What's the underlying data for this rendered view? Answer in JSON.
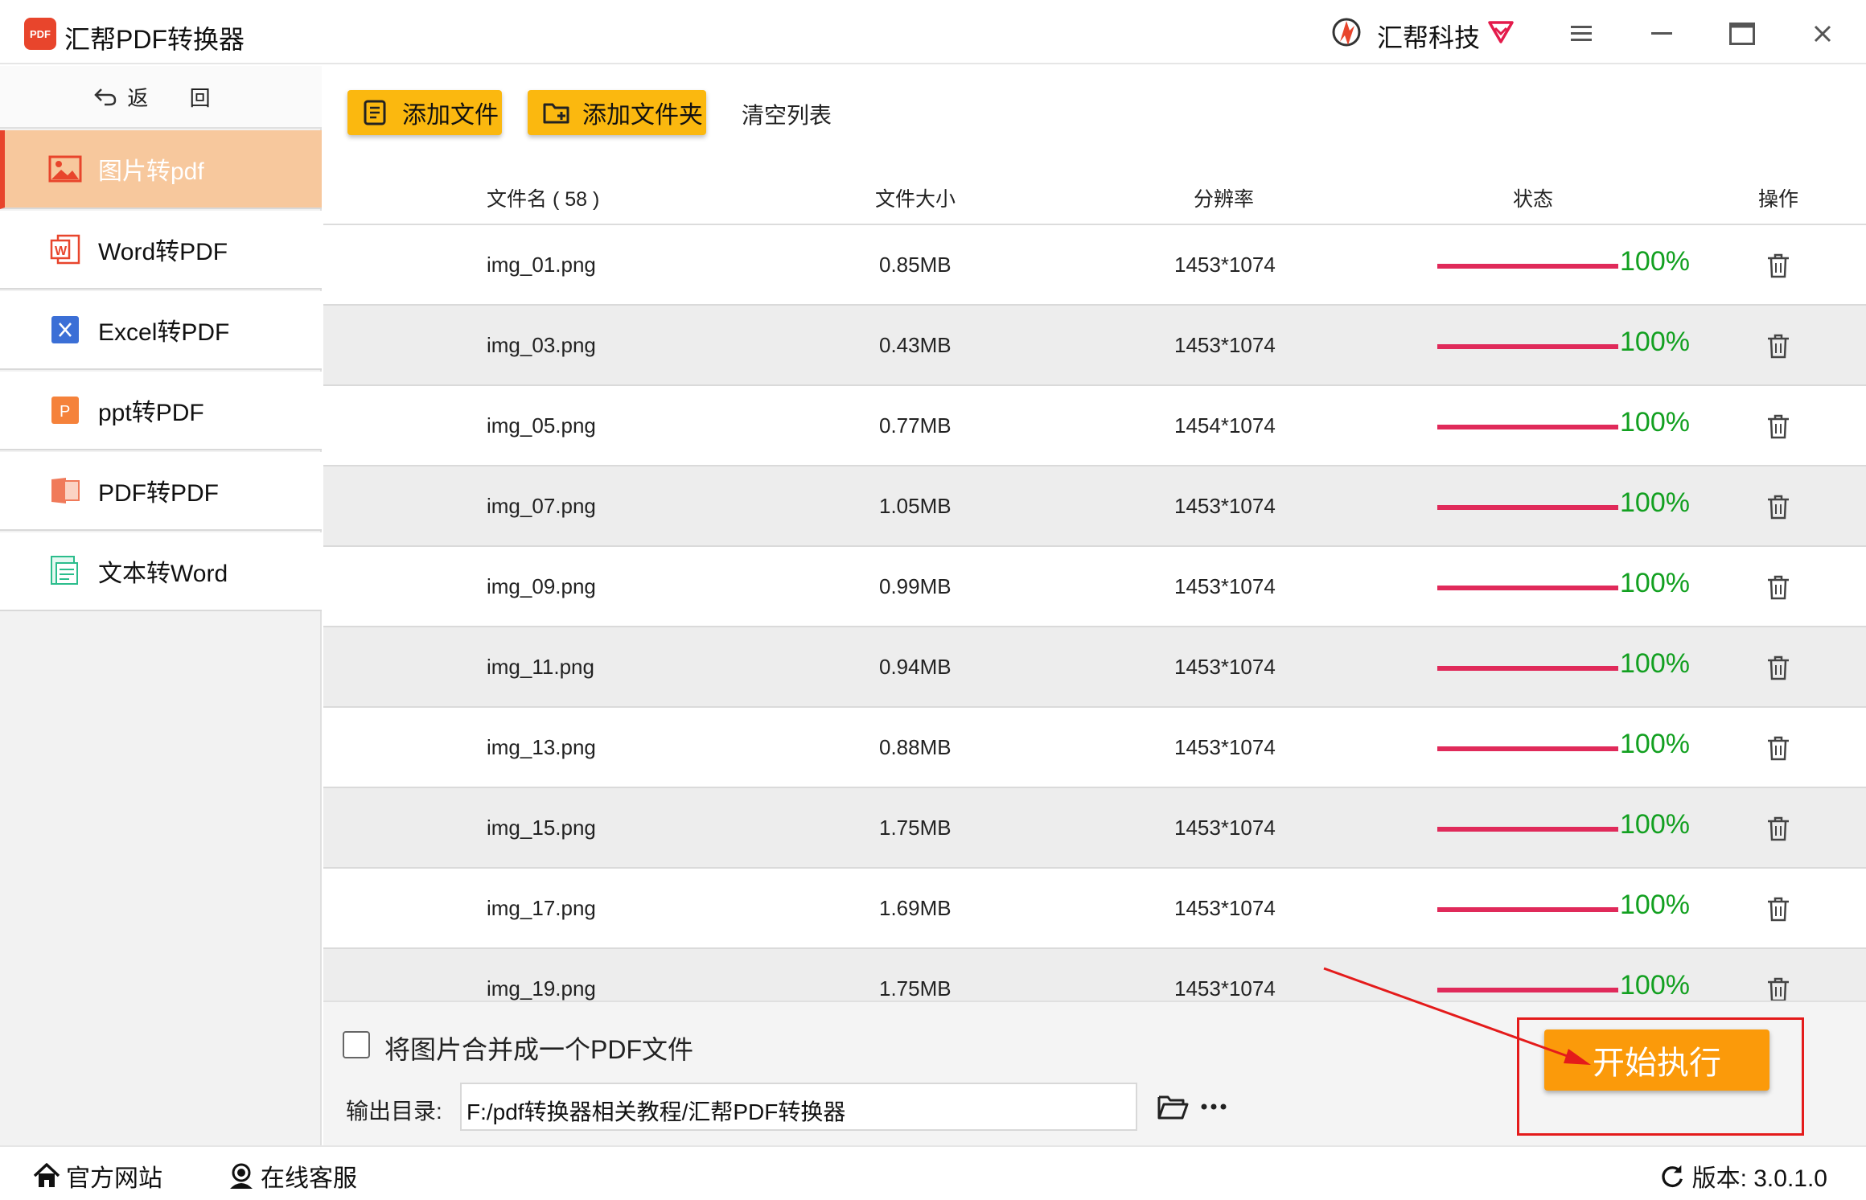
{
  "window": {
    "logo_text": "PDF",
    "title": "汇帮PDF转换器",
    "brand": "汇帮科技",
    "brand_color": "#e8452c"
  },
  "sidebar": {
    "back_label": "返  回",
    "items": [
      {
        "label": "图片转pdf",
        "icon": "image-icon",
        "active": true
      },
      {
        "label": "Word转PDF",
        "icon": "word-icon",
        "active": false
      },
      {
        "label": "Excel转PDF",
        "icon": "excel-icon",
        "active": false
      },
      {
        "label": "ppt转PDF",
        "icon": "ppt-icon",
        "active": false
      },
      {
        "label": "PDF转PDF",
        "icon": "pdf-icon",
        "active": false
      },
      {
        "label": "文本转Word",
        "icon": "text-doc-icon",
        "active": false
      }
    ]
  },
  "toolbar": {
    "add_file": "添加文件",
    "add_folder": "添加文件夹",
    "clear_list": "清空列表"
  },
  "table": {
    "headers": {
      "name": "文件名 ( 58 )",
      "size": "文件大小",
      "resolution": "分辨率",
      "status": "状态",
      "action": "操作"
    },
    "rows": [
      {
        "name": "img_01.png",
        "size": "0.85MB",
        "resolution": "1453*1074",
        "progress": 1.0,
        "status": "100%"
      },
      {
        "name": "img_03.png",
        "size": "0.43MB",
        "resolution": "1453*1074",
        "progress": 1.0,
        "status": "100%"
      },
      {
        "name": "img_05.png",
        "size": "0.77MB",
        "resolution": "1454*1074",
        "progress": 1.0,
        "status": "100%"
      },
      {
        "name": "img_07.png",
        "size": "1.05MB",
        "resolution": "1453*1074",
        "progress": 1.0,
        "status": "100%"
      },
      {
        "name": "img_09.png",
        "size": "0.99MB",
        "resolution": "1453*1074",
        "progress": 1.0,
        "status": "100%"
      },
      {
        "name": "img_11.png",
        "size": "0.94MB",
        "resolution": "1453*1074",
        "progress": 1.0,
        "status": "100%"
      },
      {
        "name": "img_13.png",
        "size": "0.88MB",
        "resolution": "1453*1074",
        "progress": 1.0,
        "status": "100%"
      },
      {
        "name": "img_15.png",
        "size": "1.75MB",
        "resolution": "1453*1074",
        "progress": 1.0,
        "status": "100%"
      },
      {
        "name": "img_17.png",
        "size": "1.69MB",
        "resolution": "1453*1074",
        "progress": 1.0,
        "status": "100%"
      },
      {
        "name": "img_19.png",
        "size": "1.75MB",
        "resolution": "1453*1074",
        "progress": 1.0,
        "status": "100%"
      }
    ]
  },
  "options": {
    "merge_label": "将图片合并成一个PDF文件",
    "merge_checked": false,
    "output_label": "输出目录:",
    "output_path": "F:/pdf转换器相关教程/汇帮PDF转换器",
    "start_label": "开始执行"
  },
  "footer": {
    "website": "官方网站",
    "support": "在线客服",
    "version": "版本:  3.0.1.0"
  },
  "colors": {
    "accent_yellow": "#fbb80f",
    "start_orange": "#fb9a0a",
    "progress_bar": "#e02a5a",
    "status_green": "#12a020",
    "annotation_red": "#e41b1b"
  }
}
